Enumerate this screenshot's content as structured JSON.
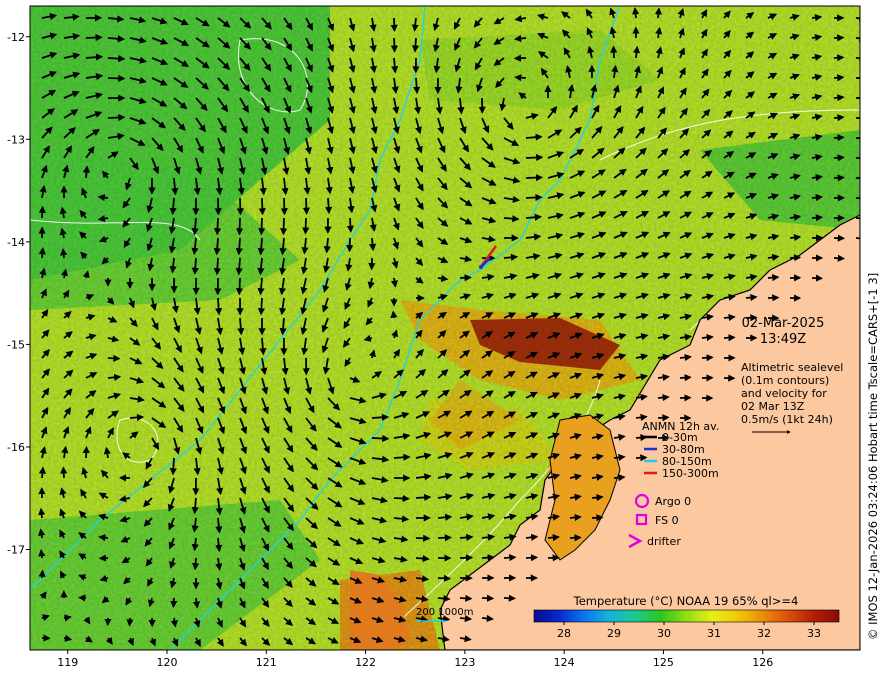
{
  "map": {
    "lon_ticks": [
      119,
      120,
      121,
      122,
      123,
      124,
      125,
      126
    ],
    "lat_ticks": [
      -12,
      -13,
      -14,
      -15,
      -16,
      -17
    ],
    "lon_range": [
      118.62,
      126.98
    ],
    "lat_range": [
      -17.98,
      -11.7
    ],
    "land_color": "#fcc8a0",
    "vector_color": "#000000",
    "contour_color": "#ffffff",
    "isobath_color": "#22d4e0"
  },
  "datetime": {
    "date": "02-Mar-2025",
    "time": "13:49Z"
  },
  "altimetry_note": {
    "line1": "Altimetric sealevel",
    "line2": "(0.1m contours)",
    "line3": "and velocity for",
    "line4": "02 Mar 13Z",
    "line5": "0.5m/s (1kt 24h)"
  },
  "anmn_legend": {
    "title": "ANMN 12h av.",
    "items": [
      {
        "label": "0-30m",
        "color": "#000000"
      },
      {
        "label": "30-80m",
        "color": "#1f2fd0"
      },
      {
        "label": "80-150m",
        "color": "#23c8e6"
      },
      {
        "label": "150-300m",
        "color": "#e31a10"
      }
    ]
  },
  "markers": {
    "argo": "Argo 0",
    "fs": "FS 0",
    "drifter": "drifter",
    "marker_color": "#e100e1"
  },
  "isobath_legend": {
    "label": "200  1000m"
  },
  "colorbar": {
    "title": "Temperature (°C) NOAA 19 65% ql>=4",
    "ticks": [
      "28",
      "29",
      "30",
      "31",
      "32",
      "33"
    ],
    "tick_values": [
      28,
      29,
      30,
      31,
      32,
      33
    ],
    "range": [
      27.4,
      33.5
    ],
    "colors": [
      "#0a0a8c",
      "#0a28d2",
      "#0a78f0",
      "#14b4dc",
      "#1ec88c",
      "#28c81e",
      "#96dc14",
      "#e6f014",
      "#f0c80a",
      "#ec8c0a",
      "#dc500a",
      "#b41e0a",
      "#8c0a0a"
    ]
  },
  "side_credit": "© IMOS 12-Jan-2026 03:24:06 Hobart time Tscale=CARS+[-1 3]"
}
